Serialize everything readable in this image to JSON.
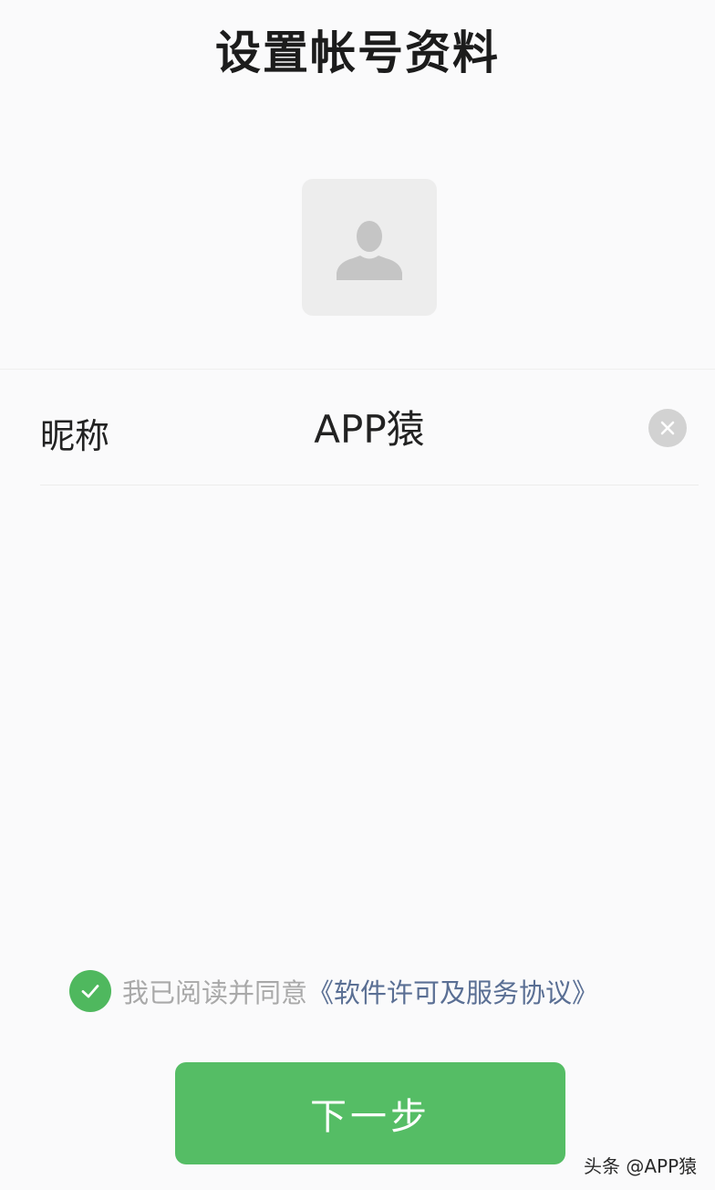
{
  "header": {
    "title": "设置帐号资料"
  },
  "avatar": {
    "icon": "person-placeholder-icon"
  },
  "nickname": {
    "label": "昵称",
    "value": "APP猿",
    "clear_icon": "close-icon"
  },
  "agreement": {
    "checked": true,
    "text": "我已阅读并同意",
    "link_text": "《软件许可及服务协议》"
  },
  "footer": {
    "next_label": "下一步"
  },
  "watermark": {
    "text": "头条 @APP猿"
  },
  "colors": {
    "accent_green": "#55bd65",
    "check_green": "#4fb85e",
    "link_blue": "#5a6f94",
    "background": "#fafafb"
  }
}
